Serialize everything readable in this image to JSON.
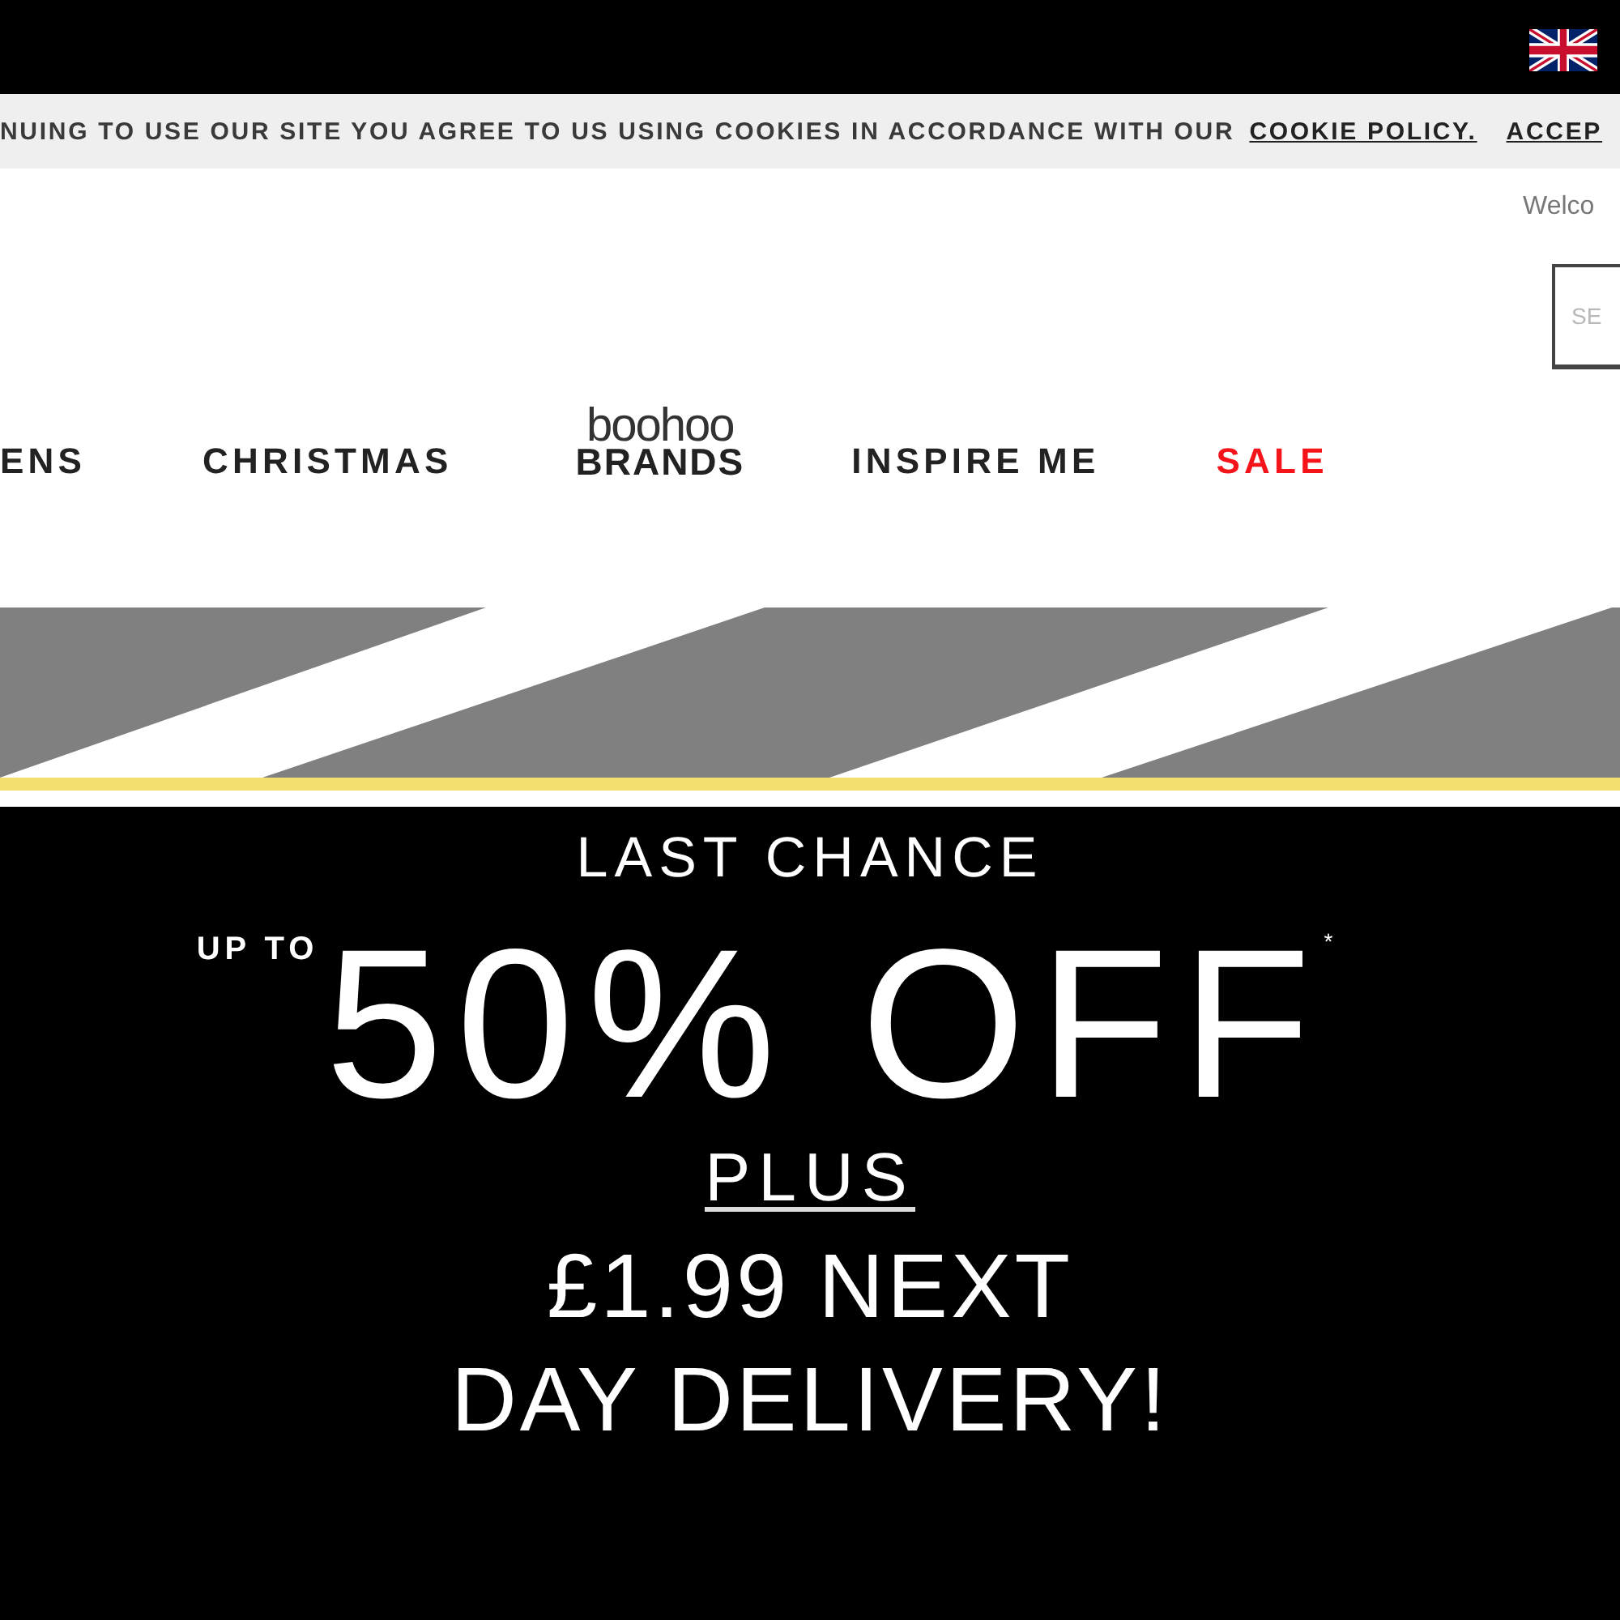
{
  "cookie_banner": {
    "message": "NUING TO USE OUR SITE YOU AGREE TO US USING COOKIES IN ACCORDANCE WITH OUR",
    "policy_link": "COOKIE POLICY.",
    "accept": "ACCEP"
  },
  "header": {
    "welcome": "Welco",
    "search": {
      "placeholder": "SE"
    }
  },
  "nav": [
    {
      "kind": "link",
      "label": "ENS"
    },
    {
      "kind": "link",
      "label": "CHRISTMAS"
    },
    {
      "kind": "brand",
      "label_top": "boohoo",
      "label": "BRANDS"
    },
    {
      "kind": "link",
      "label": "INSPIRE ME"
    },
    {
      "kind": "sale",
      "label": "SALE"
    }
  ],
  "promo": {
    "heading": "LAST CHANCE",
    "prefix": "UP TO",
    "headline": "50% OFF$^{*}$",
    "plus": "PLUS",
    "lines": [
      "£1.99 NEXT",
      "DAY DELIVERY!"
    ]
  }
}
